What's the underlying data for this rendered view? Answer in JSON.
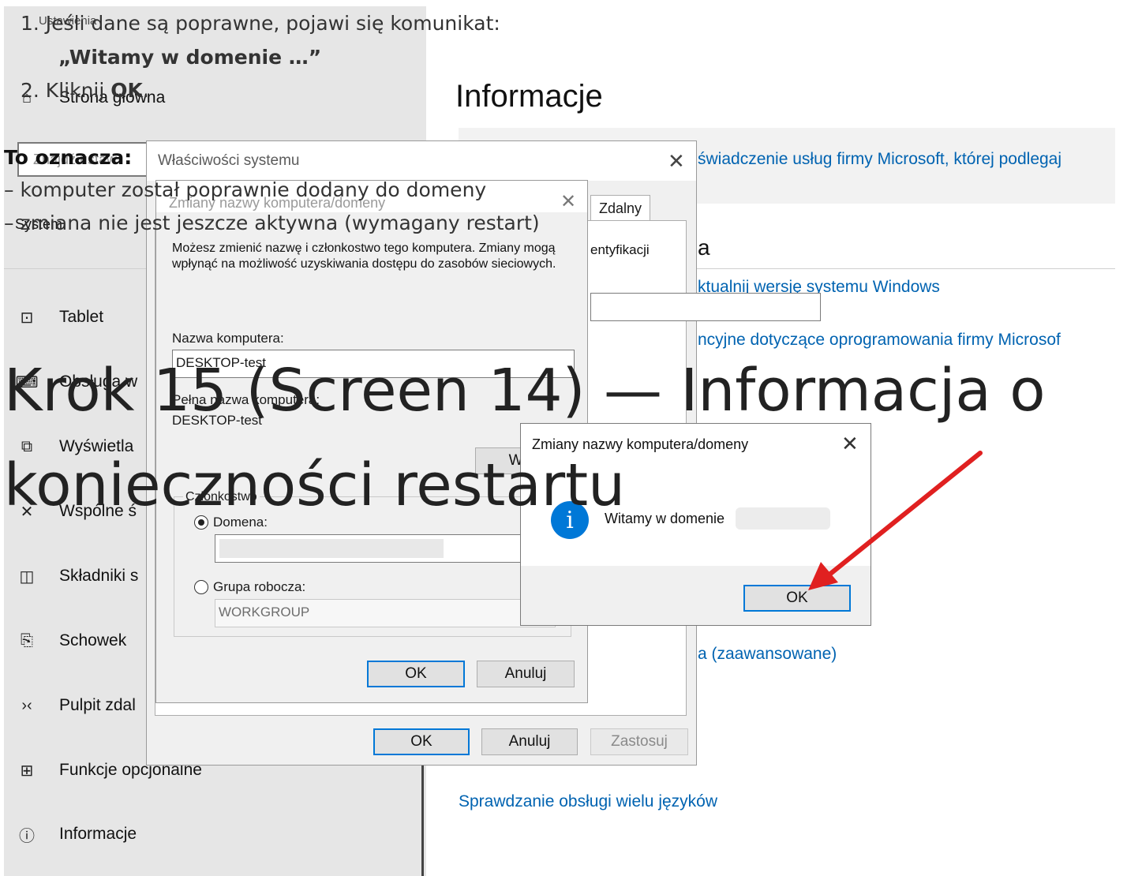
{
  "settings": {
    "header_small": "Ustawienia",
    "home": "Strona główna",
    "search_placeholder": "Znajdź ustaw",
    "section": "System",
    "nav": [
      {
        "icon": "tablet-icon",
        "glyph": "⊡",
        "label": "Tablet"
      },
      {
        "icon": "keyboard-icon",
        "glyph": "⌨",
        "label": "Obsługa w"
      },
      {
        "icon": "display-icon",
        "glyph": "⧉",
        "label": "Wyświetla"
      },
      {
        "icon": "shared-experiences-icon",
        "glyph": "✕",
        "label": "Wspólne ś"
      },
      {
        "icon": "components-icon",
        "glyph": "◫",
        "label": "Składniki s"
      },
      {
        "icon": "clipboard-icon",
        "glyph": "⎘",
        "label": "Schowek"
      },
      {
        "icon": "remote-desktop-icon",
        "glyph": "›‹",
        "label": "Pulpit zdal"
      },
      {
        "icon": "optional-features-icon",
        "glyph": "⊞",
        "label": "Funkcje opcjonalne"
      },
      {
        "icon": "info-icon",
        "glyph": "ⓘ",
        "label": "Informacje"
      }
    ],
    "main_title": "Informacje",
    "link_microsoft": "świadczenie usług firmy Microsoft, której podlegaj",
    "section_letter": "a",
    "link_update": "ktualnij wersję systemu Windows",
    "link_license": "ncyjne dotyczące oprogramowania firmy Microsof",
    "link_advanced": "a (zaawansowane)",
    "link_languages": "Sprawdzanie obsługi wielu języków"
  },
  "sysprops": {
    "title": "Właściwości systemu",
    "tab_remote": "Zdalny",
    "ident_text": "entyfikacji",
    "ok": "OK",
    "cancel": "Anuluj",
    "apply": "Zastosuj"
  },
  "rename": {
    "title": "Zmiany nazwy komputera/domeny",
    "description": "Możesz zmienić nazwę i członkostwo tego komputera. Zmiany mogą wpłynąć na możliwość uzyskiwania dostępu do zasobów sieciowych.",
    "name_label": "Nazwa komputera:",
    "name_value": "DESKTOP-test",
    "full_label": "Pełna nazwa komputera:",
    "full_value": "DESKTOP-test",
    "more_button": "Wię",
    "membership_label": "Członkostwo",
    "domain_label": "Domena:",
    "workgroup_label": "Grupa robocza:",
    "workgroup_value": "WORKGROUP",
    "ok": "OK",
    "cancel": "Anuluj"
  },
  "welcome": {
    "title": "Zmiany nazwy komputera/domeny",
    "info_glyph": "i",
    "message": "Witamy w domenie",
    "ok": "OK"
  },
  "overlay": {
    "step1": "1. Jeśli dane są poprawne, pojawi się komunikat:",
    "quote": "„Witamy w domenie …”",
    "step2_prefix": "2. Kliknij ",
    "step2_bold": "OK",
    "step2_suffix": ".",
    "means": "To oznacza:",
    "bullet1": "– komputer został poprawnie dodany do domeny",
    "bullet2": "– zmiana nie jest jeszcze aktywna (wymagany restart)",
    "headline": "Krok 15 (Screen 14) — Informacja o konieczności restartu"
  },
  "colors": {
    "accent": "#0078d7",
    "link": "#0063b1",
    "arrow": "#e02020",
    "sidebar": "#e6e6e6"
  }
}
